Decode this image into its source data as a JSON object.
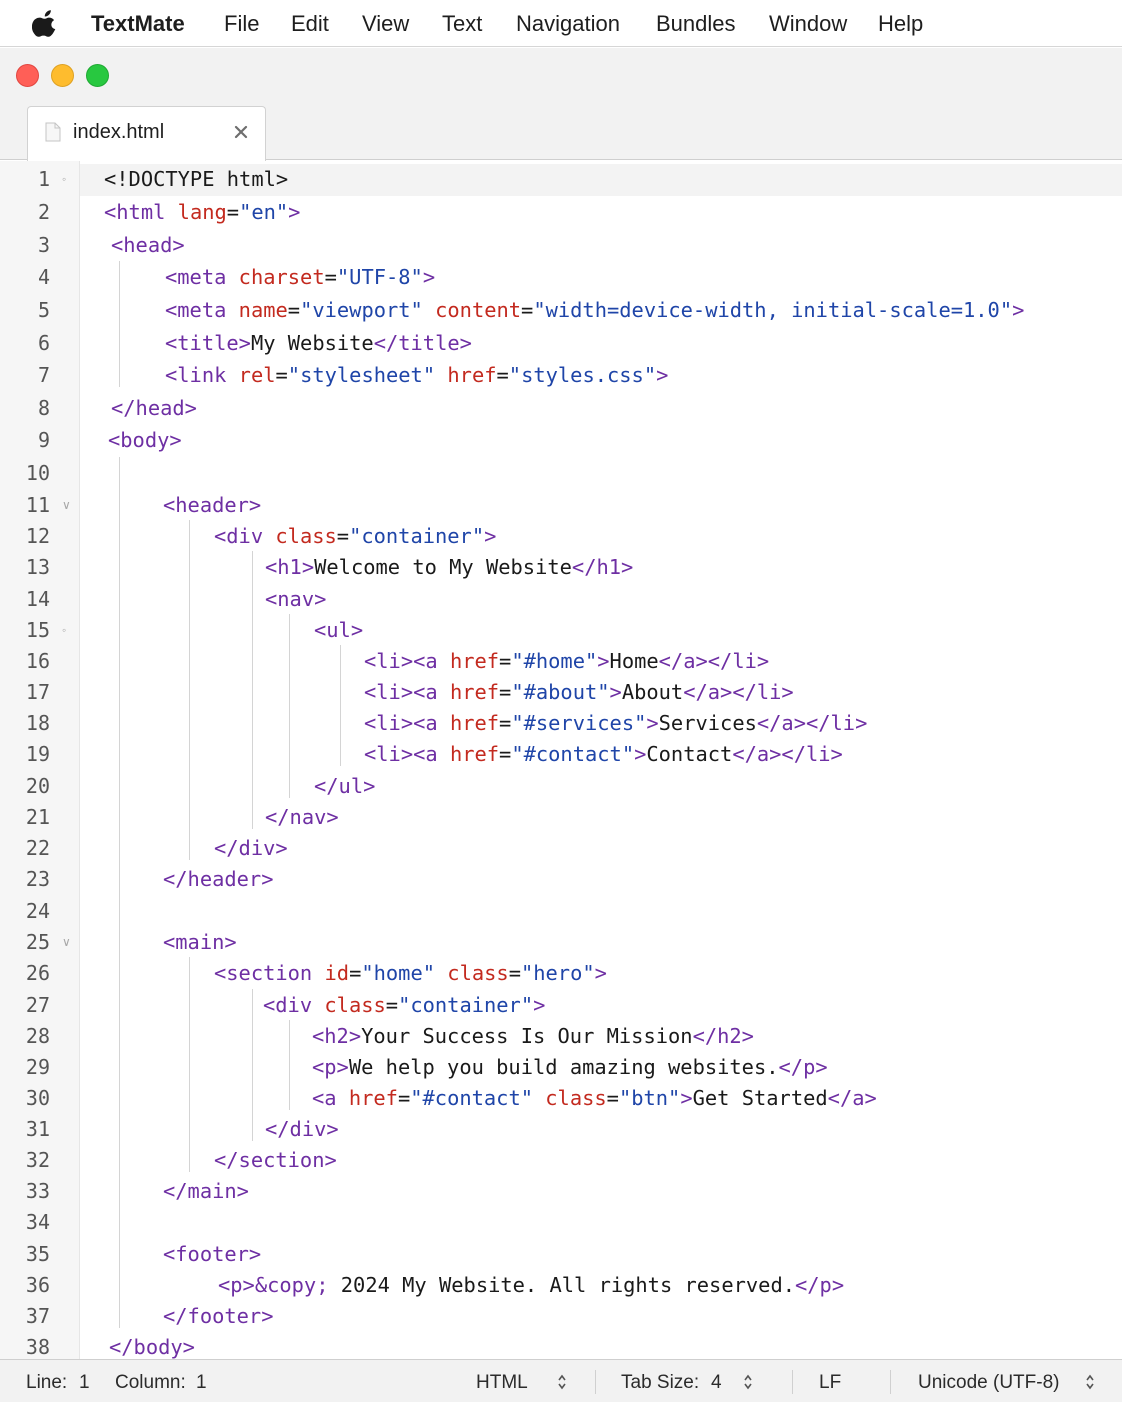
{
  "menubar": {
    "app_name": "TextMate",
    "items": [
      "File",
      "Edit",
      "View",
      "Text",
      "Navigation",
      "Bundles",
      "Window",
      "Help"
    ]
  },
  "window": {
    "tab": {
      "label": "index.html"
    }
  },
  "editor": {
    "language": "HTML",
    "current_line": 1,
    "fold_markers": [
      1,
      11,
      15,
      25
    ],
    "lines": [
      [
        [
          "txt",
          "<!DOCTYPE html>"
        ]
      ],
      [
        [
          "tag",
          "<html "
        ],
        [
          "attr",
          "lang"
        ],
        [
          "txt",
          "="
        ],
        [
          "str",
          "\"en\""
        ],
        [
          "tag",
          ">"
        ]
      ],
      [
        [
          "tag",
          "<head>"
        ]
      ],
      [
        [
          "tag",
          "<meta "
        ],
        [
          "attr",
          "charset"
        ],
        [
          "txt",
          "="
        ],
        [
          "str",
          "\"UTF-8\""
        ],
        [
          "tag",
          ">"
        ]
      ],
      [
        [
          "tag",
          "<meta "
        ],
        [
          "attr",
          "name"
        ],
        [
          "txt",
          "="
        ],
        [
          "str",
          "\"viewport\""
        ],
        [
          "txt",
          " "
        ],
        [
          "attr",
          "content"
        ],
        [
          "txt",
          "="
        ],
        [
          "str",
          "\"width=device-width, initial-scale=1.0\""
        ],
        [
          "tag",
          ">"
        ]
      ],
      [
        [
          "tag",
          "<title>"
        ],
        [
          "txt",
          "My Website"
        ],
        [
          "tag",
          "</title>"
        ]
      ],
      [
        [
          "tag",
          "<link "
        ],
        [
          "attr",
          "rel"
        ],
        [
          "txt",
          "="
        ],
        [
          "str",
          "\"stylesheet\""
        ],
        [
          "txt",
          " "
        ],
        [
          "attr",
          "href"
        ],
        [
          "txt",
          "="
        ],
        [
          "str",
          "\"styles.css\""
        ],
        [
          "tag",
          ">"
        ]
      ],
      [
        [
          "tag",
          "</head>"
        ]
      ],
      [
        [
          "tag",
          "<body>"
        ]
      ],
      [],
      [
        [
          "tag",
          "<header>"
        ]
      ],
      [
        [
          "tag",
          "<div "
        ],
        [
          "attr",
          "class"
        ],
        [
          "txt",
          "="
        ],
        [
          "str",
          "\"container\""
        ],
        [
          "tag",
          ">"
        ]
      ],
      [
        [
          "tag",
          "<h1>"
        ],
        [
          "txt",
          "Welcome to My Website"
        ],
        [
          "tag",
          "</h1>"
        ]
      ],
      [
        [
          "tag",
          "<nav>"
        ]
      ],
      [
        [
          "tag",
          "<ul>"
        ]
      ],
      [
        [
          "tag",
          "<li><a "
        ],
        [
          "attr",
          "href"
        ],
        [
          "txt",
          "="
        ],
        [
          "str",
          "\"#home\""
        ],
        [
          "tag",
          ">"
        ],
        [
          "txt",
          "Home"
        ],
        [
          "tag",
          "</a></li>"
        ]
      ],
      [
        [
          "tag",
          "<li><a "
        ],
        [
          "attr",
          "href"
        ],
        [
          "txt",
          "="
        ],
        [
          "str",
          "\"#about\""
        ],
        [
          "tag",
          ">"
        ],
        [
          "txt",
          "About"
        ],
        [
          "tag",
          "</a></li>"
        ]
      ],
      [
        [
          "tag",
          "<li><a "
        ],
        [
          "attr",
          "href"
        ],
        [
          "txt",
          "="
        ],
        [
          "str",
          "\"#services\""
        ],
        [
          "tag",
          ">"
        ],
        [
          "txt",
          "Services"
        ],
        [
          "tag",
          "</a></li>"
        ]
      ],
      [
        [
          "tag",
          "<li><a "
        ],
        [
          "attr",
          "href"
        ],
        [
          "txt",
          "="
        ],
        [
          "str",
          "\"#contact\""
        ],
        [
          "tag",
          ">"
        ],
        [
          "txt",
          "Contact"
        ],
        [
          "tag",
          "</a></li>"
        ]
      ],
      [
        [
          "tag",
          "</ul>"
        ]
      ],
      [
        [
          "tag",
          "</nav>"
        ]
      ],
      [
        [
          "tag",
          "</div>"
        ]
      ],
      [
        [
          "tag",
          "</header>"
        ]
      ],
      [],
      [
        [
          "tag",
          "<main>"
        ]
      ],
      [
        [
          "tag",
          "<section "
        ],
        [
          "attr",
          "id"
        ],
        [
          "txt",
          "="
        ],
        [
          "str",
          "\"home\""
        ],
        [
          "txt",
          " "
        ],
        [
          "attr",
          "class"
        ],
        [
          "txt",
          "="
        ],
        [
          "str",
          "\"hero\""
        ],
        [
          "tag",
          ">"
        ]
      ],
      [
        [
          "tag",
          "<div "
        ],
        [
          "attr",
          "class"
        ],
        [
          "txt",
          "="
        ],
        [
          "str",
          "\"container\""
        ],
        [
          "tag",
          ">"
        ]
      ],
      [
        [
          "tag",
          "<h2>"
        ],
        [
          "txt",
          "Your Success Is Our Mission"
        ],
        [
          "tag",
          "</h2>"
        ]
      ],
      [
        [
          "tag",
          "<p>"
        ],
        [
          "txt",
          "We help you build amazing websites."
        ],
        [
          "tag",
          "</p>"
        ]
      ],
      [
        [
          "tag",
          "<a "
        ],
        [
          "attr",
          "href"
        ],
        [
          "txt",
          "="
        ],
        [
          "str",
          "\"#contact\""
        ],
        [
          "txt",
          " "
        ],
        [
          "attr",
          "class"
        ],
        [
          "txt",
          "="
        ],
        [
          "str",
          "\"btn\""
        ],
        [
          "tag",
          ">"
        ],
        [
          "txt",
          "Get Started"
        ],
        [
          "tag",
          "</a>"
        ]
      ],
      [
        [
          "tag",
          "</div>"
        ]
      ],
      [
        [
          "tag",
          "</section>"
        ]
      ],
      [
        [
          "tag",
          "</main>"
        ]
      ],
      [],
      [
        [
          "tag",
          "<footer>"
        ]
      ],
      [
        [
          "tag",
          "<p>&copy;"
        ],
        [
          "txt",
          " 2024 My Website. All rights reserved."
        ],
        [
          "tag",
          "</p>"
        ]
      ],
      [
        [
          "tag",
          "</footer>"
        ]
      ],
      [
        [
          "tag",
          "</body>"
        ]
      ]
    ]
  },
  "statusbar": {
    "line_label": "Line:",
    "line_value": "1",
    "column_label": "Column:",
    "column_value": "1",
    "syntax": "HTML",
    "tab_size_label": "Tab Size:",
    "tab_size_value": "4",
    "line_endings": "LF",
    "encoding": "Unicode (UTF-8)"
  },
  "colors": {
    "tag": "#6e2fa3",
    "attribute": "#c32a1f",
    "string": "#1f45a8",
    "text": "#1a1a1a",
    "close_button": "#ff5f57",
    "minimize_button": "#febc2e",
    "zoom_button": "#28c840"
  }
}
